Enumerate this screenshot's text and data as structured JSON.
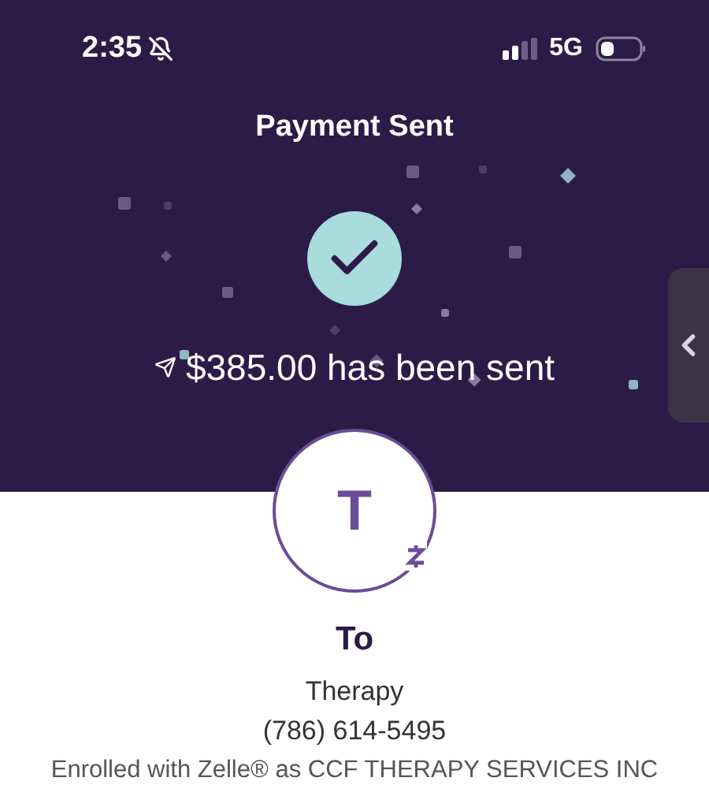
{
  "status_bar": {
    "time": "2:35",
    "network": "5G"
  },
  "header": {
    "title": "Payment Sent"
  },
  "confirmation": {
    "message": "$385.00 has been sent"
  },
  "recipient": {
    "initial": "T",
    "label": "To",
    "name": "Therapy",
    "phone": "(786) 614-5495",
    "enrollment": "Enrolled with Zelle® as CCF THERAPY SERVICES INC"
  }
}
